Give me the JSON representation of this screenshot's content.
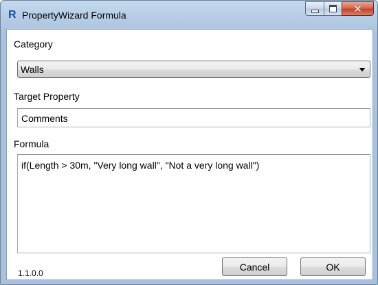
{
  "window": {
    "title": "PropertyWizard Formula",
    "app_logo": "R",
    "close_glyph": "✕"
  },
  "category": {
    "label": "Category",
    "selected": "Walls"
  },
  "target_property": {
    "label": "Target Property",
    "value": "Comments"
  },
  "formula": {
    "label": "Formula",
    "value": "if(Length > 30m, \"Very long wall\", \"Not a very long wall\")"
  },
  "footer": {
    "version": "1.1.0.0",
    "cancel_label": "Cancel",
    "ok_label": "OK"
  }
}
